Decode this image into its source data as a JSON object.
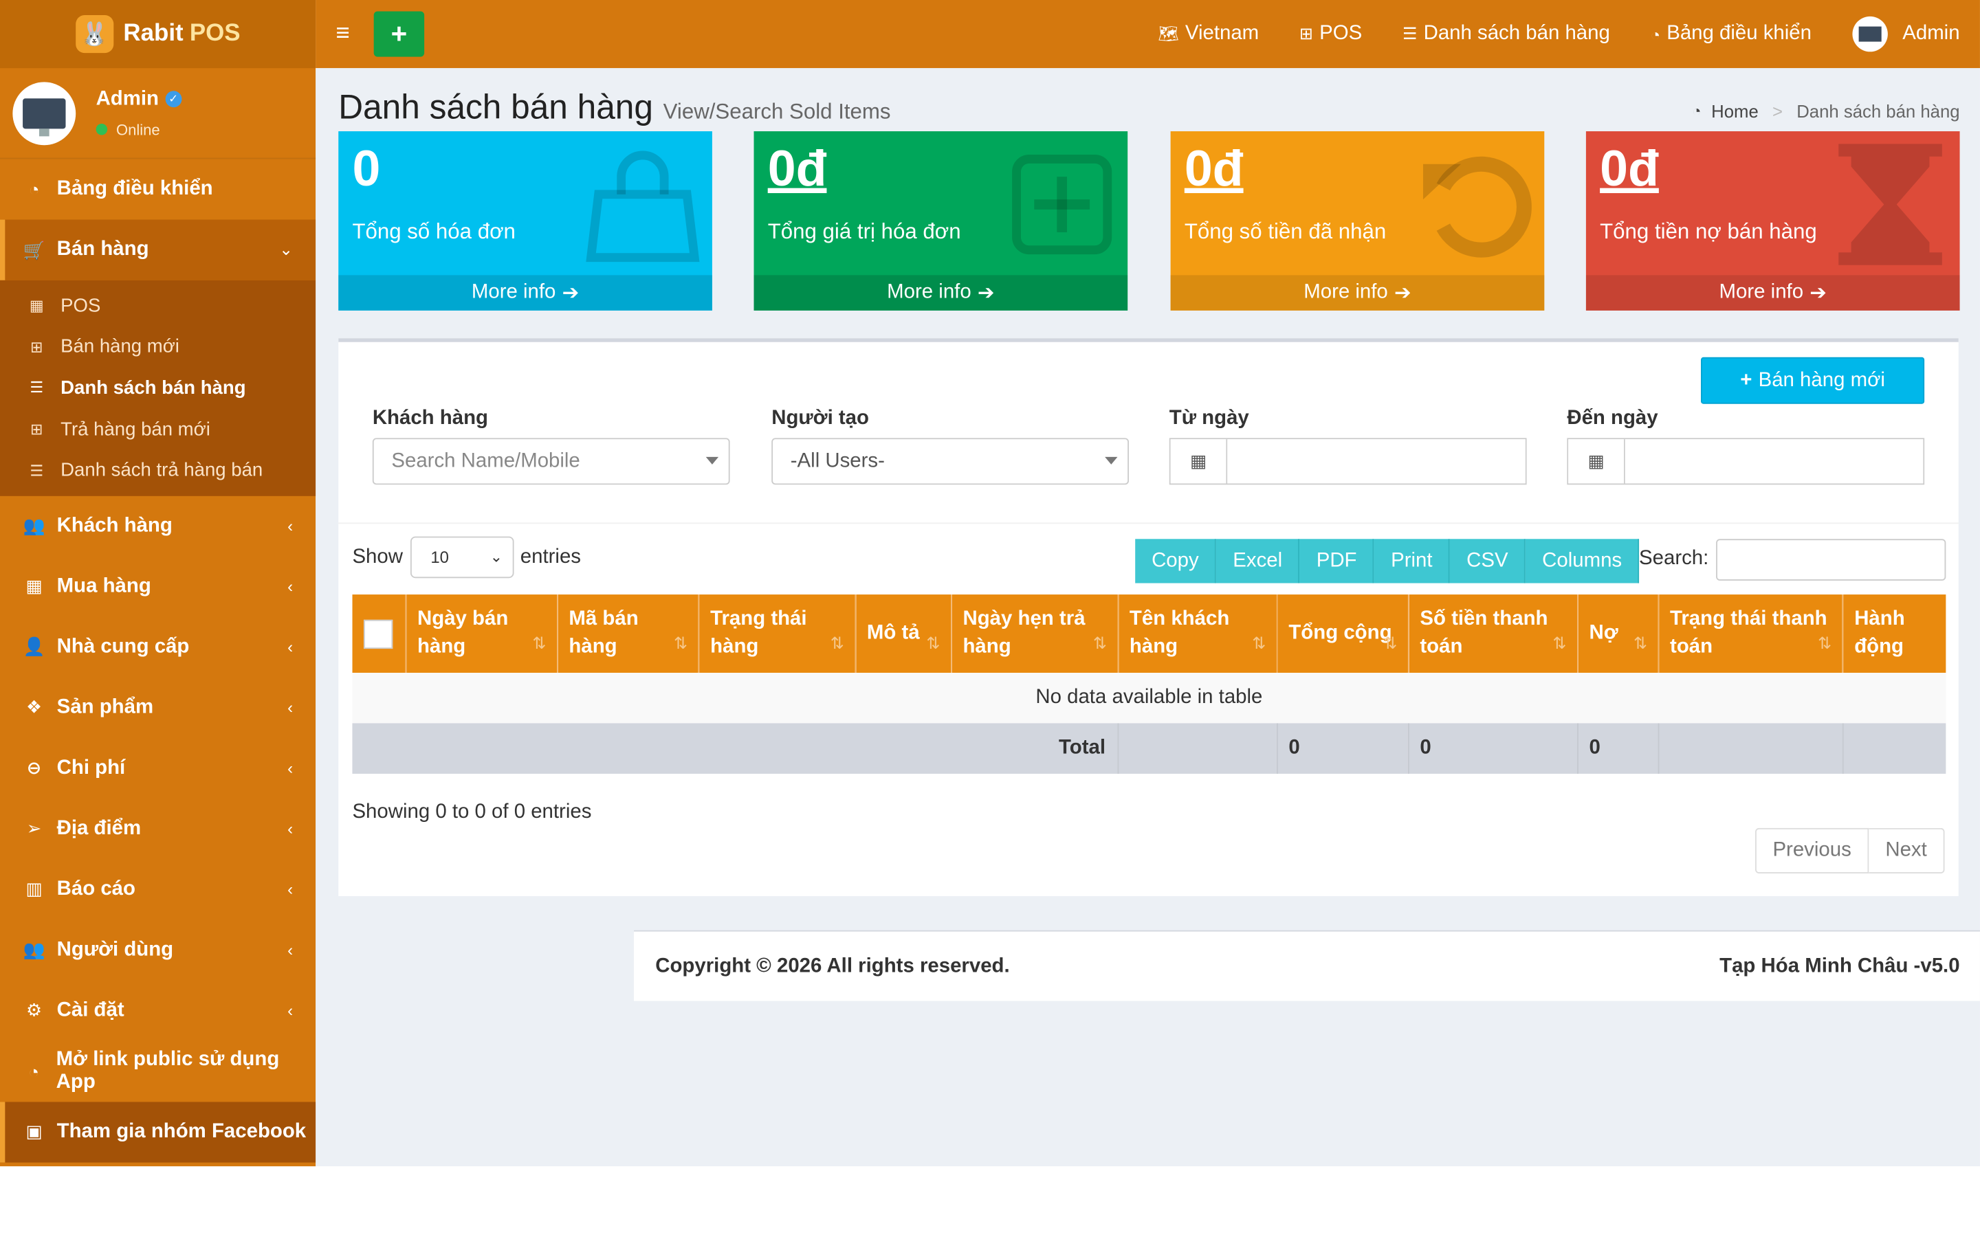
{
  "brand": {
    "name": "Rabit",
    "name_accent": "POS"
  },
  "user": {
    "name": "Admin",
    "status": "Online"
  },
  "sidebar": {
    "items": [
      {
        "label": "Bảng điều khiển"
      },
      {
        "label": "Bán hàng"
      },
      {
        "label": "Khách hàng"
      },
      {
        "label": "Mua hàng"
      },
      {
        "label": "Nhà cung cấp"
      },
      {
        "label": "Sản phẩm"
      },
      {
        "label": "Chi phí"
      },
      {
        "label": "Địa điểm"
      },
      {
        "label": "Báo cáo"
      },
      {
        "label": "Người dùng"
      },
      {
        "label": "Cài đặt"
      },
      {
        "label": "Mở link public sử dụng App"
      },
      {
        "label": "Tham gia nhóm Facebook"
      }
    ],
    "sales_sub": [
      {
        "label": "POS"
      },
      {
        "label": "Bán hàng mới"
      },
      {
        "label": "Danh sách bán hàng"
      },
      {
        "label": "Trả hàng bán mới"
      },
      {
        "label": "Danh sách trả hàng bán"
      }
    ]
  },
  "header": {
    "lang": "Vietnam",
    "pos": "POS",
    "sales_list": "Danh sách bán hàng",
    "dashboard": "Bảng điều khiển",
    "user": "Admin",
    "plus": "+"
  },
  "page": {
    "title": "Danh sách bán hàng",
    "subtitle": "View/Search Sold Items",
    "breadcrumb_home": "Home",
    "breadcrumb_sep": ">",
    "breadcrumb_current": "Danh sách bán hàng"
  },
  "tiles": [
    {
      "value": "0",
      "label": "Tổng số hóa đơn",
      "more": "More info",
      "bg": "#00c0ef",
      "foot": "#00a7d0"
    },
    {
      "value": "0đ",
      "label": "Tổng giá trị hóa đơn",
      "more": "More info",
      "bg": "#00a65a",
      "foot": "#008d4c"
    },
    {
      "value": "0đ",
      "label": "Tổng số tiền đã nhận",
      "more": "More info",
      "bg": "#f39c12",
      "foot": "#da8c10"
    },
    {
      "value": "0đ",
      "label": "Tổng tiền nợ bán hàng",
      "more": "More info",
      "bg": "#dd4b39",
      "foot": "#c64333"
    }
  ],
  "filters": {
    "new_sale_button": "Bán hàng mới",
    "customer_label": "Khách hàng",
    "customer_placeholder": "Search Name/Mobile",
    "creator_label": "Người tạo",
    "creator_value": "-All Users-",
    "from_label": "Từ ngày",
    "to_label": "Đến ngày"
  },
  "table": {
    "show": "Show",
    "length": "10",
    "entries": "entries",
    "buttons": [
      "Copy",
      "Excel",
      "PDF",
      "Print",
      "CSV",
      "Columns"
    ],
    "search_label": "Search:",
    "columns": [
      "Ngày bán hàng",
      "Mã bán hàng",
      "Trạng thái hàng",
      "Mô tả",
      "Ngày hẹn trả hàng",
      "Tên khách hàng",
      "Tổng cộng",
      "Số tiền thanh toán",
      "Nợ",
      "Trạng thái thanh toán",
      "Hành động"
    ],
    "empty": "No data available in table",
    "total_label": "Total",
    "total_sum": "0",
    "total_paid": "0",
    "total_debt": "0",
    "info": "Showing 0 to 0 of 0 entries",
    "prev": "Previous",
    "next": "Next"
  },
  "footer": {
    "copyright": "Copyright © 2026 All rights reserved.",
    "store": "Tạp Hóa Minh Châu -v5.0"
  },
  "colors": {
    "primary": "#d4780e",
    "header_th": "#e98a0e"
  }
}
